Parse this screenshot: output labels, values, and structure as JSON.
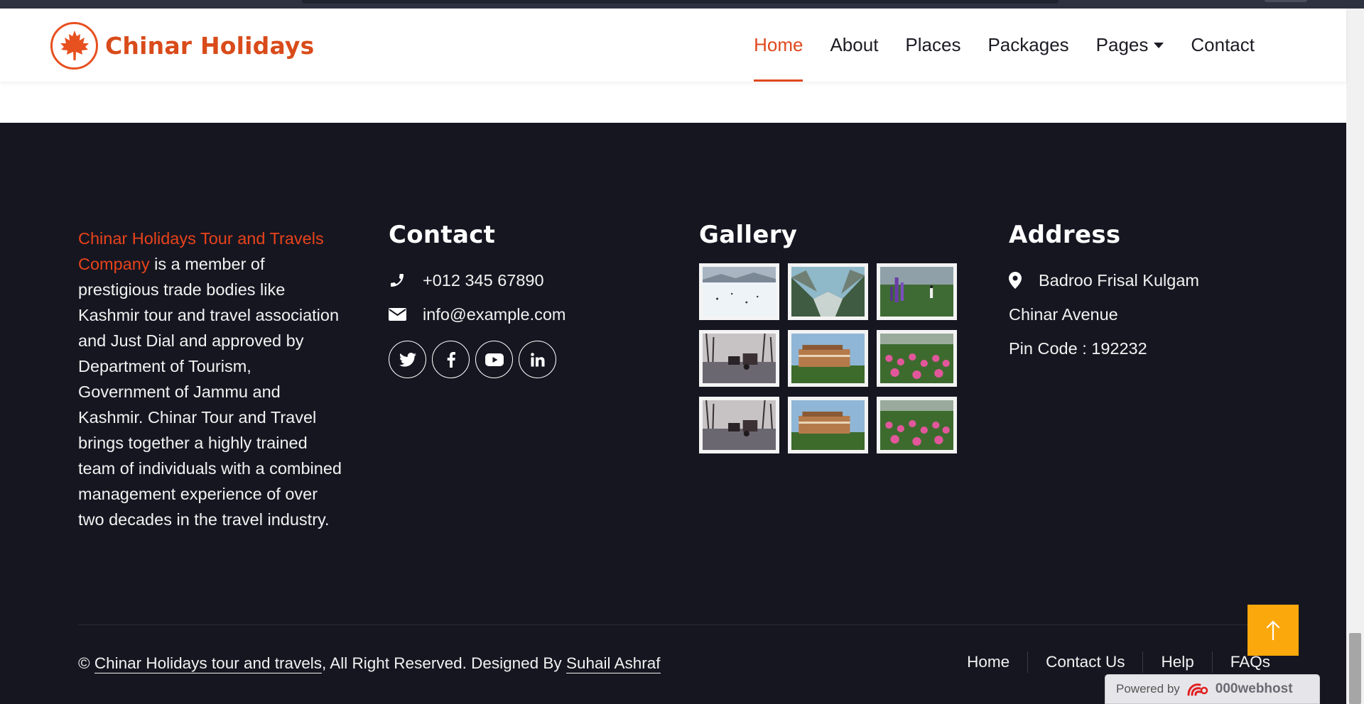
{
  "navbar": {
    "brand": "Chinar Holidays",
    "items": [
      {
        "label": "Home"
      },
      {
        "label": "About"
      },
      {
        "label": "Places"
      },
      {
        "label": "Packages"
      },
      {
        "label": "Pages"
      },
      {
        "label": "Contact"
      }
    ],
    "active": "Home"
  },
  "footer": {
    "about": {
      "highlight": "Chinar Holidays Tour and Travels Company",
      "text": " is a member of prestigious trade bodies like Kashmir tour and travel association and Just Dial and approved by Department of Tourism, Government of Jammu and Kashmir. Chinar Tour and Travel brings together a highly trained team of individuals with a combined management experience of over two decades in the travel industry."
    },
    "contact": {
      "heading": "Contact",
      "phone": "+012 345 67890",
      "email": "info@example.com",
      "socials": [
        "twitter-icon",
        "facebook-icon",
        "youtube-icon",
        "linkedin-icon"
      ]
    },
    "gallery": {
      "heading": "Gallery",
      "images": [
        "snowy-field",
        "mountain-valley",
        "lupine-field",
        "horse-carriage-snow",
        "houseboat",
        "tulip-field",
        "horse-carriage-snow",
        "houseboat",
        "tulip-field"
      ]
    },
    "address": {
      "heading": "Address",
      "line1": "Badroo Frisal Kulgam",
      "line2": "Chinar Avenue",
      "line3": "Pin Code : 192232"
    },
    "copyright": {
      "symbol": "©",
      "company": "Chinar Holidays tour and travels",
      "middle": ", All Right Reserved. Designed By ",
      "designer": "Suhail Ashraf"
    },
    "menu": [
      {
        "label": "Home"
      },
      {
        "label": "Contact Us"
      },
      {
        "label": "Help"
      },
      {
        "label": "FAQs"
      }
    ]
  },
  "powered_by": {
    "label": "Powered by",
    "brand": "000webhost"
  },
  "colors": {
    "accent": "#e0481d",
    "footer_bg": "#161621",
    "back_to_top": "#fba80c"
  }
}
